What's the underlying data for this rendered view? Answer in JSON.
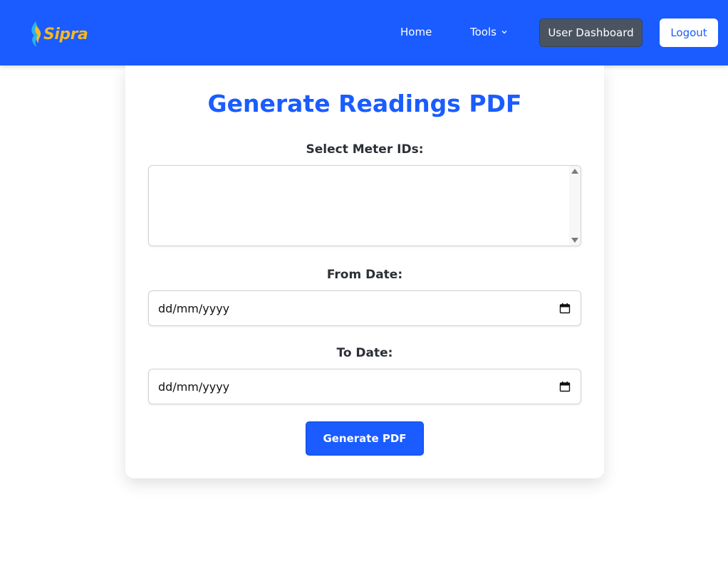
{
  "navbar": {
    "logo_text": "Sipra",
    "links": {
      "home": "Home",
      "tools": "Tools"
    },
    "dashboard_label": "User Dashboard",
    "logout_label": "Logout",
    "icons": {
      "tools_dropdown": "chevron-down-icon",
      "logo_mark": "flame-icon"
    }
  },
  "form": {
    "title": "Generate Readings PDF",
    "meter_label": "Select Meter IDs:",
    "meter_options": [],
    "from_label": "From Date:",
    "from_value": "dd/mm/yyyy",
    "to_label": "To Date:",
    "to_value": "dd/mm/yyyy",
    "submit_label": "Generate PDF",
    "icons": {
      "date_picker": "calendar-icon"
    }
  },
  "colors": {
    "brand_blue": "#1a5cff",
    "dashboard_button": "#4a5461",
    "logo_accent": "#f4b82a"
  }
}
